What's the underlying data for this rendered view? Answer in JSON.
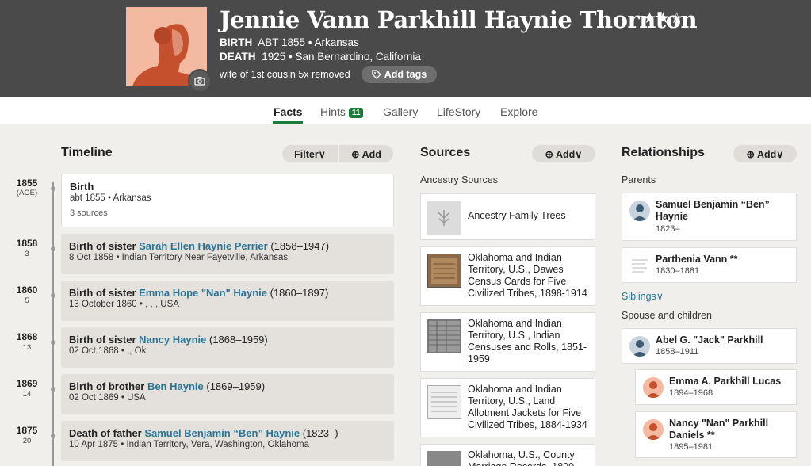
{
  "person": {
    "name": "Jennie Vann Parkhill Haynie Thornton",
    "stars": "★★☆",
    "birth_label": "BIRTH",
    "birth_value": "ABT 1855 • Arkansas",
    "death_label": "DEATH",
    "death_value": "1925 • San Bernardino, California",
    "relationship": "wife of 1st cousin 5x removed",
    "add_tags": "Add tags"
  },
  "tabs": [
    {
      "label": "Facts"
    },
    {
      "label": "Hints",
      "badge": "11"
    },
    {
      "label": "Gallery"
    },
    {
      "label": "LifeStory"
    },
    {
      "label": "Explore"
    }
  ],
  "timeline": {
    "title": "Timeline",
    "filter": "Filter∨",
    "add": "⊕ Add",
    "events": [
      {
        "year": "1855",
        "age": "(AGE)",
        "title": "Birth",
        "sub": "abt 1855 • Arkansas",
        "sources": "3 sources"
      },
      {
        "year": "1858",
        "age": "3",
        "prefix": "Birth of sister ",
        "link": "Sarah Ellen Haynie Perrier",
        "dates": " (1858–1947)",
        "sub": "8 Oct 1858 • Indian Territory Near Fayetville, Arkansas"
      },
      {
        "year": "1860",
        "age": "5",
        "prefix": "Birth of sister ",
        "link": "Emma Hope \"Nan\" Haynie",
        "dates": " (1860–1897)",
        "sub": "13 October 1860 • , , , USA"
      },
      {
        "year": "1868",
        "age": "13",
        "prefix": "Birth of sister ",
        "link": "Nancy Haynie",
        "dates": " (1868–1959)",
        "sub": "02 Oct 1868 • ,, Ok"
      },
      {
        "year": "1869",
        "age": "14",
        "prefix": "Birth of brother ",
        "link": "Ben Haynie",
        "dates": " (1869–1959)",
        "sub": "02 Oct 1869 • USA"
      },
      {
        "year": "1875",
        "age": "20",
        "prefix": "Death of father ",
        "link": "Samuel Benjamin “Ben” Haynie",
        "dates": " (1823–)",
        "sub": "10 Apr 1875 • Indian Territory, Vera, Washington, Oklahoma"
      }
    ]
  },
  "sources": {
    "title": "Sources",
    "add": "⊕ Add∨",
    "subhead": "Ancestry Sources",
    "items": [
      {
        "text": "Ancestry Family Trees"
      },
      {
        "text": "Oklahoma and Indian Territory, U.S., Dawes Census Cards for Five Civilized Tribes, 1898-1914"
      },
      {
        "text": "Oklahoma and Indian Territory, U.S., Indian Censuses and Rolls, 1851-1959"
      },
      {
        "text": "Oklahoma and Indian Territory, U.S., Land Allotment Jackets for Five Civilized Tribes, 1884-1934"
      },
      {
        "text": "Oklahoma, U.S., County Marriage Records, 1890-"
      }
    ]
  },
  "relationships": {
    "title": "Relationships",
    "add": "⊕ Add∨",
    "parents_label": "Parents",
    "parents": [
      {
        "name": "Samuel Benjamin “Ben” Haynie",
        "dates": "1823–"
      },
      {
        "name": "Parthenia Vann **",
        "dates": "1830–1881"
      }
    ],
    "siblings_label": "Siblings∨",
    "spouse_label": "Spouse and children",
    "spouse": {
      "name": "Abel G. \"Jack\" Parkhill",
      "dates": "1858–1911"
    },
    "children": [
      {
        "name": "Emma A. Parkhill Lucas",
        "dates": "1894–1968"
      },
      {
        "name": "Nancy \"Nan\" Parkhill Daniels **",
        "dates": "1895–1981"
      }
    ]
  },
  "colors": {
    "header": "#4a4a4a",
    "link": "#2a7596",
    "accent": "#1a7e3a",
    "background": "#f1efec"
  }
}
